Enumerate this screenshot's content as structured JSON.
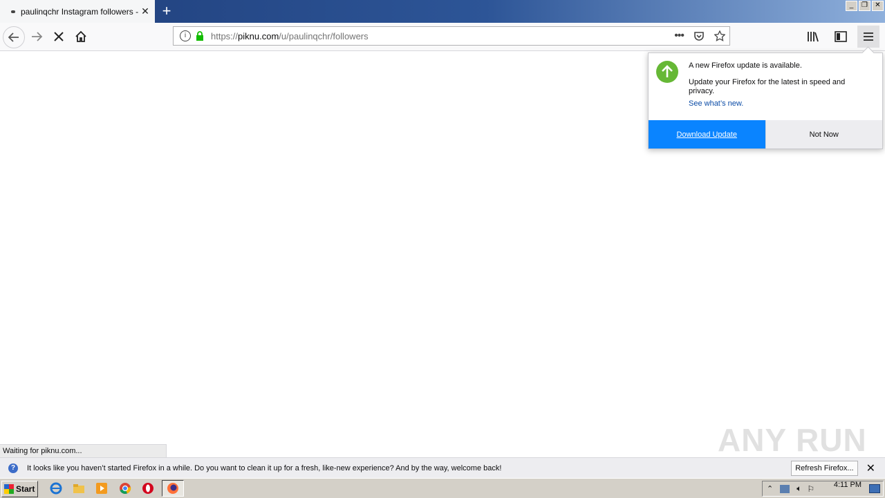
{
  "browser": {
    "tab_title": "paulinqchr Instagram followers - Pi",
    "url_prefix": "https://",
    "url_host": "piknu.com",
    "url_path": "/u/paulinqchr/followers",
    "window_buttons": [
      "_",
      "❐",
      "✕"
    ]
  },
  "doorhanger": {
    "title": "A new Firefox update is available.",
    "text": "Update your Firefox for the latest in speed and privacy.",
    "link": "See what’s new.",
    "download_label": "Download Update",
    "notnow_label": "Not Now"
  },
  "status": {
    "text": "Waiting for piknu.com..."
  },
  "notification": {
    "text": "It looks like you haven’t started Firefox in a while. Do you want to clean it up for a fresh, like-new experience? And by the way, welcome back!",
    "button": "Refresh Firefox...",
    "close": "✕"
  },
  "taskbar": {
    "start_label": "Start",
    "clock": "4:11 PM"
  },
  "watermark": "ANY RUN",
  "colors": {
    "accent": "#0a84ff",
    "update_icon": "#66b836",
    "lock": "#12bc00"
  }
}
